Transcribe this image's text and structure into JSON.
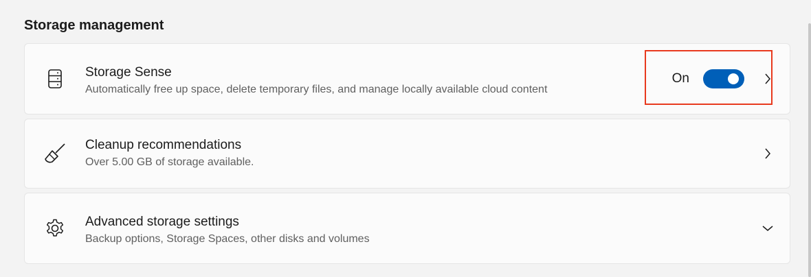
{
  "section": {
    "title": "Storage management"
  },
  "items": [
    {
      "title": "Storage Sense",
      "subtitle": "Automatically free up space, delete temporary files, and manage locally available cloud content",
      "icon": "storage-drive-icon",
      "toggle_state": "On",
      "toggle_on": true
    },
    {
      "title": "Cleanup recommendations",
      "subtitle": "Over 5.00 GB of storage available.",
      "icon": "broom-icon"
    },
    {
      "title": "Advanced storage settings",
      "subtitle": "Backup options, Storage Spaces, other disks and volumes",
      "icon": "gear-icon"
    }
  ],
  "colors": {
    "accent": "#005fb8",
    "highlight": "#e8391d",
    "background": "#f3f3f3",
    "card": "#fbfbfb"
  }
}
